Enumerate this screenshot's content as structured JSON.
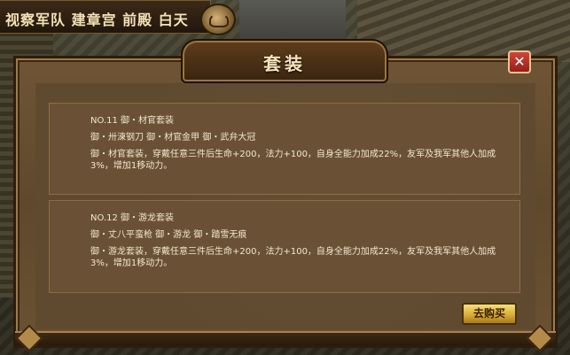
{
  "location": {
    "text": "视察军队 建章宫 前殿 白天"
  },
  "dialog": {
    "title": "套装",
    "close_label": "✕",
    "buy_label": "去购买"
  },
  "suits": [
    {
      "header": "NO.11 御・材官套装",
      "pieces": "御・卅湅钢刀  御・材官金甲  御・武弁大冠",
      "description": "御・材官套装，穿戴任意三件后生命+200，法力+100，自身全能力加成22%，友军及我军其他人加成3%，增加1移动力。"
    },
    {
      "header": "NO.12 御・游龙套装",
      "pieces": "御・丈八平蛮枪  御・游龙  御・踏雪无痕",
      "description": "御・游龙套装，穿戴任意三件后生命+200，法力+100，自身全能力加成22%，友军及我军其他人加成3%，增加1移动力。"
    }
  ],
  "icons": {
    "location_emblem": "dragon-icon",
    "close": "close-icon"
  },
  "colors": {
    "panel": "#6a5135",
    "title_text": "#f5e4b8",
    "close_button": "#c0392b",
    "buy_button": "#d8ad38"
  }
}
